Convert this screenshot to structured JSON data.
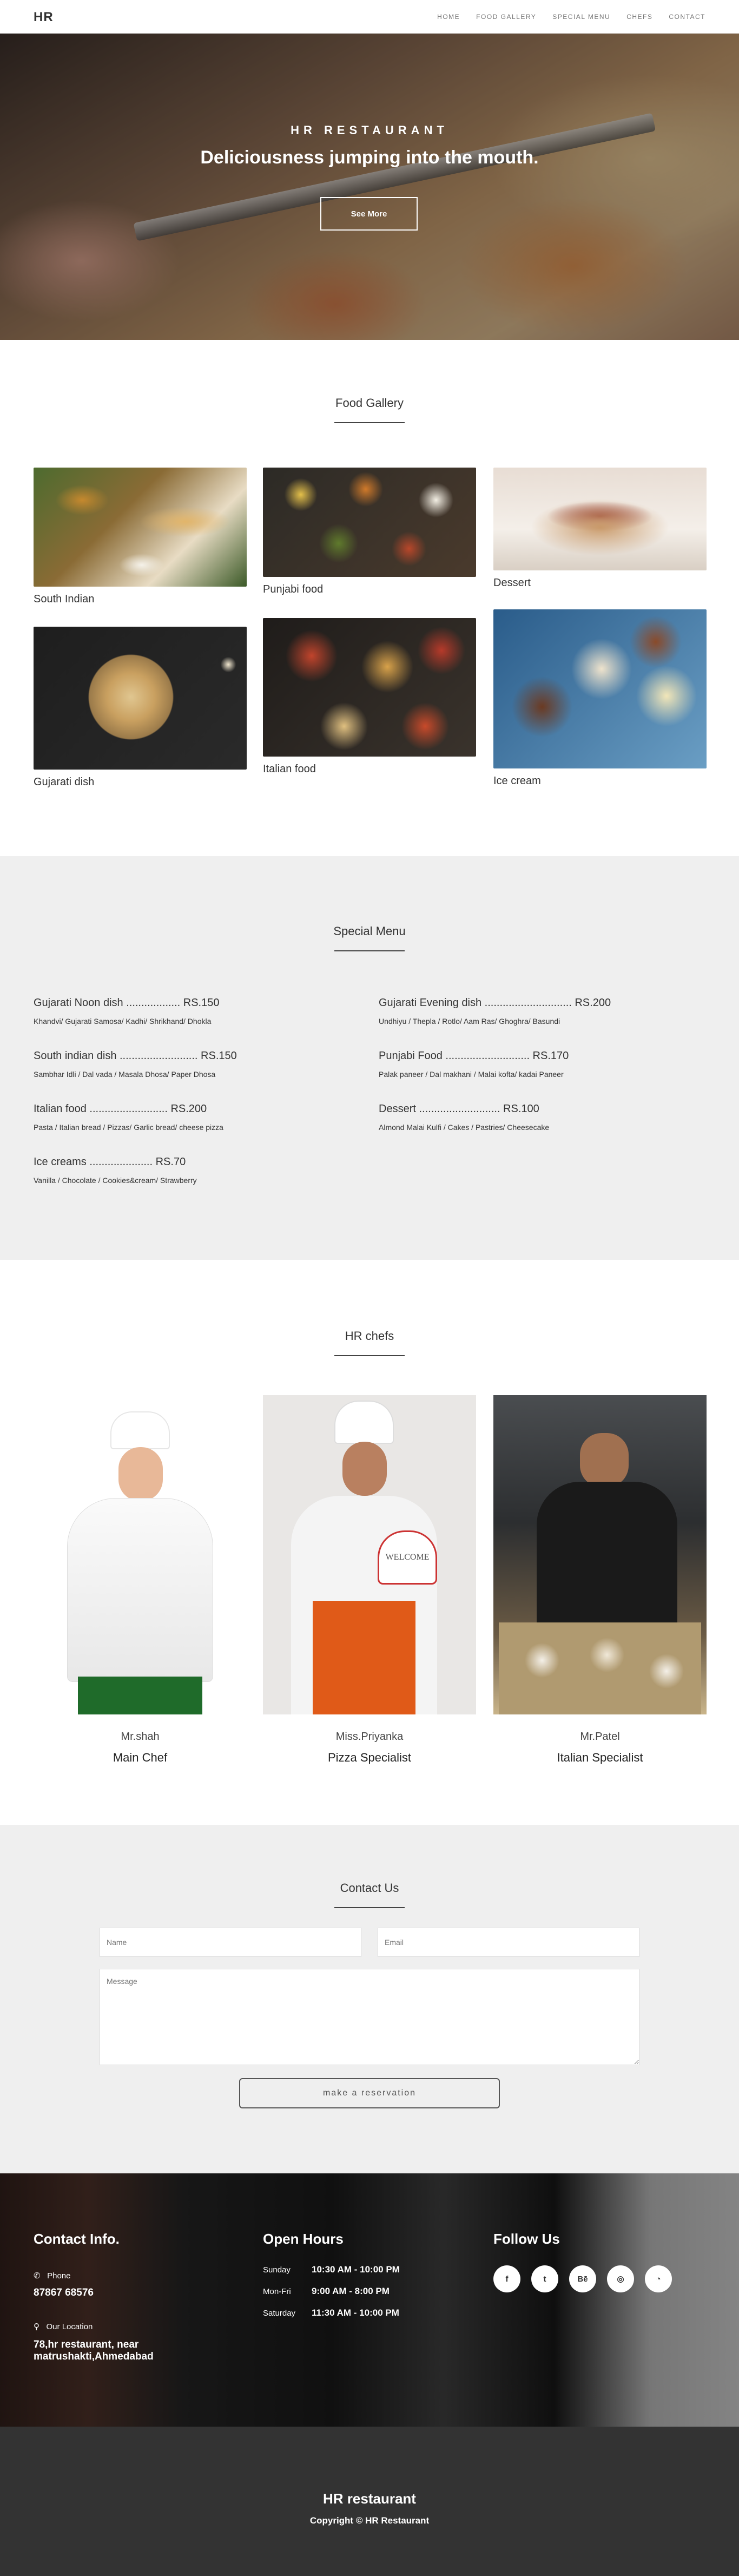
{
  "nav": {
    "brand": "HR",
    "links": [
      "HOME",
      "FOOD GALLERY",
      "SPECIAL MENU",
      "CHEFS",
      "CONTACT"
    ]
  },
  "hero": {
    "kicker": "HR RESTAURANT",
    "title": "Deliciousness jumping into the mouth.",
    "button": "See More"
  },
  "gallery": {
    "title": "Food Gallery",
    "items": [
      {
        "caption": "South Indian"
      },
      {
        "caption": "Punjabi food"
      },
      {
        "caption": "Dessert"
      },
      {
        "caption": "Gujarati dish"
      },
      {
        "caption": "Italian food"
      },
      {
        "caption": "Ice cream"
      }
    ]
  },
  "menu": {
    "title": "Special Menu",
    "items": [
      {
        "title": "Gujarati Noon dish .................. RS.150",
        "desc": "Khandvi/ Gujarati Samosa/ Kadhi/ Shrikhand/ Dhokla"
      },
      {
        "title": "Gujarati Evening dish ............................. RS.200",
        "desc": "Undhiyu / Thepla / Rotlo/ Aam Ras/ Ghoghra/ Basundi"
      },
      {
        "title": "South indian dish .......................... RS.150",
        "desc": "Sambhar Idli / Dal vada / Masala Dhosa/ Paper Dhosa"
      },
      {
        "title": "Punjabi Food ............................ RS.170",
        "desc": "Palak paneer / Dal makhani / Malai kofta/ kadai Paneer"
      },
      {
        "title": "Italian food .......................... RS.200",
        "desc": "Pasta / Italian bread / Pizzas/ Garlic bread/ cheese pizza"
      },
      {
        "title": "Dessert ........................... RS.100",
        "desc": "Almond Malai Kulfi / Cakes / Pastries/ Cheesecake"
      },
      {
        "title": "Ice creams ..................... RS.70",
        "desc": "Vanilla / Chocolate / Cookies&cream/ Strawberry"
      }
    ]
  },
  "chefs": {
    "title": "HR chefs",
    "items": [
      {
        "name": "Mr.shah",
        "role": "Main Chef"
      },
      {
        "name": "Miss.Priyanka",
        "role": "Pizza Specialist"
      },
      {
        "name": "Mr.Patel",
        "role": "Italian Specialist"
      }
    ],
    "sign_text": "WELCOME"
  },
  "contact": {
    "title": "Contact Us",
    "name_placeholder": "Name",
    "email_placeholder": "Email",
    "message_placeholder": "Message",
    "submit": "make a reservation"
  },
  "info": {
    "contact_title": "Contact Info.",
    "phone_label": "Phone",
    "phone": "87867 68576",
    "location_label": "Our Location",
    "address": "78,hr restaurant, near matrushakti,Ahmedabad",
    "hours_title": "Open Hours",
    "hours": [
      {
        "day": "Sunday",
        "time": "10:30 AM - 10:00 PM"
      },
      {
        "day": "Mon-Fri",
        "time": "9:00 AM - 8:00 PM"
      },
      {
        "day": "Saturday",
        "time": "11:30 AM - 10:00 PM"
      }
    ],
    "follow_title": "Follow Us",
    "social": [
      {
        "icon": "facebook-icon",
        "glyph": "f"
      },
      {
        "icon": "twitter-icon",
        "glyph": "t"
      },
      {
        "icon": "behance-icon",
        "glyph": "Bē"
      },
      {
        "icon": "dribbble-icon",
        "glyph": "◎"
      },
      {
        "icon": "github-icon",
        "glyph": "◔"
      }
    ]
  },
  "footer": {
    "title": "HR restaurant",
    "copyright": "Copyright © HR Restaurant"
  }
}
